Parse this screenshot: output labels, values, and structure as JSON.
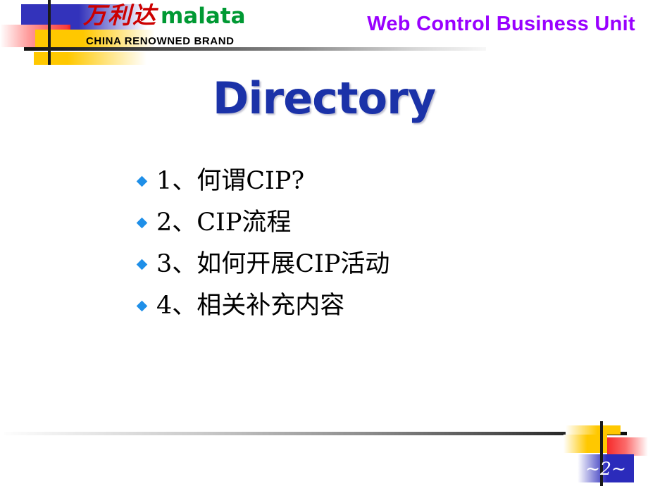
{
  "slide": {
    "title": "Directory",
    "page_number": "~2~"
  },
  "header": {
    "logo_chinese": "万利达",
    "logo_english": "malata",
    "logo_tagline": "CHINA RENOWNED BRAND",
    "unit_title": "Web Control Business Unit"
  },
  "bullets": [
    {
      "marker": "diamond-bullet-icon",
      "text": "1、何谓CIP?"
    },
    {
      "marker": "diamond-bullet-icon",
      "text": "2、CIP流程"
    },
    {
      "marker": "diamond-bullet-icon",
      "text": "3、如何开展CIP活动"
    },
    {
      "marker": "diamond-bullet-icon",
      "text": "4、相关补充内容"
    }
  ],
  "colors": {
    "title_blue": "#1b32a8",
    "unit_purple": "#9900ff",
    "logo_red": "#cc0000",
    "logo_green": "#009933",
    "bullet_blue": "#1f8fe8",
    "deco_blue": "#3333bb",
    "deco_yellow": "#ffc800",
    "deco_red": "#f62b2b"
  }
}
